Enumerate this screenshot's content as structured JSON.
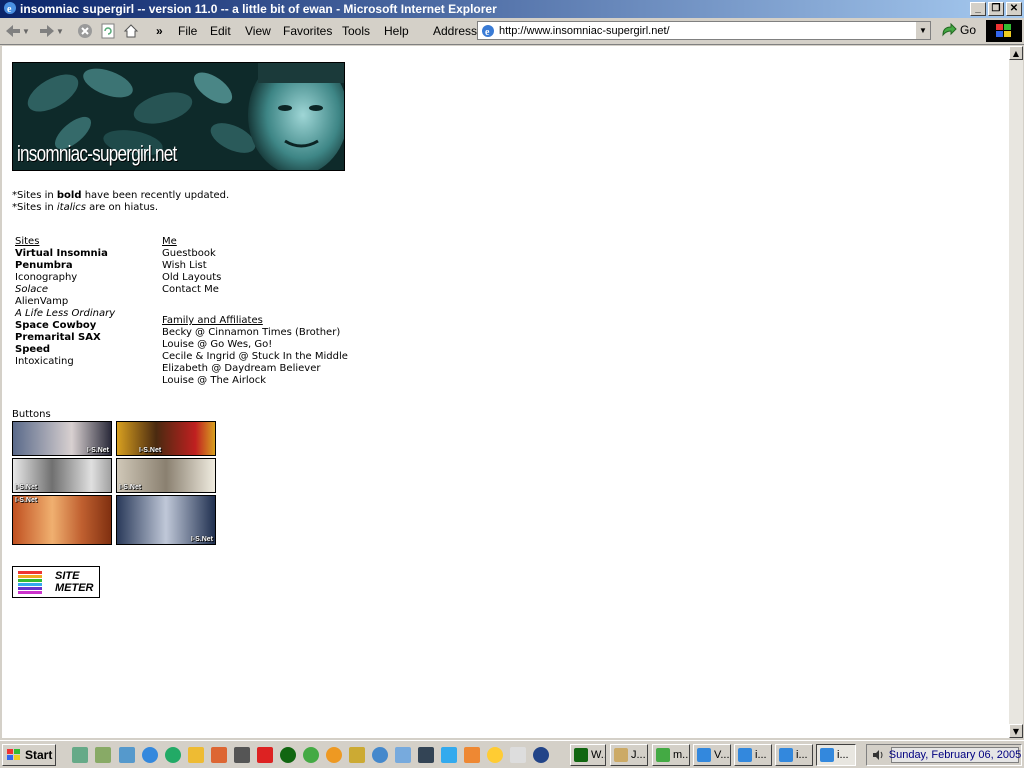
{
  "window": {
    "title": "insomniac supergirl -- version 11.0 -- a little bit of ewan - Microsoft Internet Explorer",
    "minimize": "_",
    "maximize": "❐",
    "close": "✕"
  },
  "toolbar": {
    "back_icon": "back-arrow-icon",
    "forward_icon": "forward-arrow-icon",
    "chevron": "»",
    "menus": [
      "File",
      "Edit",
      "View",
      "Favorites",
      "Tools",
      "Help"
    ],
    "address_label": "Address",
    "address_value": "http://www.insomniac-supergirl.net/",
    "go_label": "Go"
  },
  "page": {
    "banner_text": "insomniac-supergirl.net",
    "note_bold_prefix": "*Sites in ",
    "note_bold_word": "bold",
    "note_bold_suffix": " have been recently updated.",
    "note_italic_prefix": "*Sites in ",
    "note_italic_word": "italics",
    "note_italic_suffix": " are on hiatus.",
    "sites_header": "Sites",
    "sites": [
      {
        "label": "Virtual Insomnia",
        "style": "bold"
      },
      {
        "label": "Penumbra",
        "style": "bold"
      },
      {
        "label": "Iconography",
        "style": "normal"
      },
      {
        "label": "Solace",
        "style": "italic"
      },
      {
        "label": "AlienVamp",
        "style": "normal"
      },
      {
        "label": "A Life Less Ordinary",
        "style": "italic"
      },
      {
        "label": "Space Cowboy",
        "style": "bold"
      },
      {
        "label": "Premarital SAX",
        "style": "bold"
      },
      {
        "label": "Speed",
        "style": "bold"
      },
      {
        "label": "Intoxicating",
        "style": "normal"
      }
    ],
    "me_header": "Me",
    "me_links": [
      "Guestbook",
      "Wish List",
      "Old Layouts",
      "Contact Me"
    ],
    "family_header": "Family and Affiliates",
    "family_links": [
      "Becky @ Cinnamon Times (Brother)",
      "Louise @ Go Wes, Go!",
      "Cecile & Ingrid @ Stuck In the Middle",
      "Elizabeth @ Daydream Believer",
      "Louise @ The Airlock"
    ],
    "buttons_label": "Buttons",
    "button_tag": "I-S.Net",
    "sitemeter_line1": "SITE",
    "sitemeter_line2": "METER"
  },
  "taskbar": {
    "start_label": "Start",
    "tasks": [
      "W...",
      "J...",
      "m...",
      "V...",
      "i...",
      "i...",
      "i..."
    ],
    "clock": "Sunday, February 06, 2005"
  },
  "colors": {
    "titlebar": "#0a246a",
    "banner_bg": "#0e2a2a",
    "clock_text": "#000080"
  }
}
